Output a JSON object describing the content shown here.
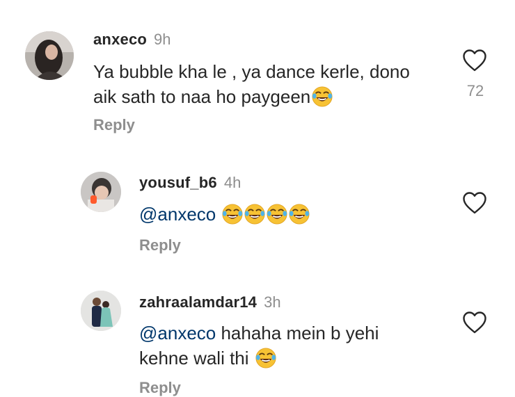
{
  "comments": [
    {
      "username": "anxeco",
      "time": "9h",
      "text_line1": "Ya bubble kha le , ya dance kerle, dono",
      "text_line2": "aik sath to naa ho paygeen",
      "emoji": "face-with-tears-of-joy",
      "likes": "72",
      "reply_label": "Reply"
    },
    {
      "username": "yousuf_b6",
      "time": "4h",
      "mention": "@anxeco",
      "emoji": "face-with-tears-of-joy",
      "emoji_count": 4,
      "reply_label": "Reply"
    },
    {
      "username": "zahraalamdar14",
      "time": "3h",
      "mention": "@anxeco",
      "text_line1": "hahaha mein b yehi",
      "text_line2": "kehne wali thi",
      "emoji": "face-with-tears-of-joy",
      "reply_label": "Reply"
    }
  ],
  "icons": {
    "like": "heart-outline-icon"
  },
  "colors": {
    "text": "#262626",
    "secondary": "#8e8e8e",
    "mention": "#00376b"
  }
}
